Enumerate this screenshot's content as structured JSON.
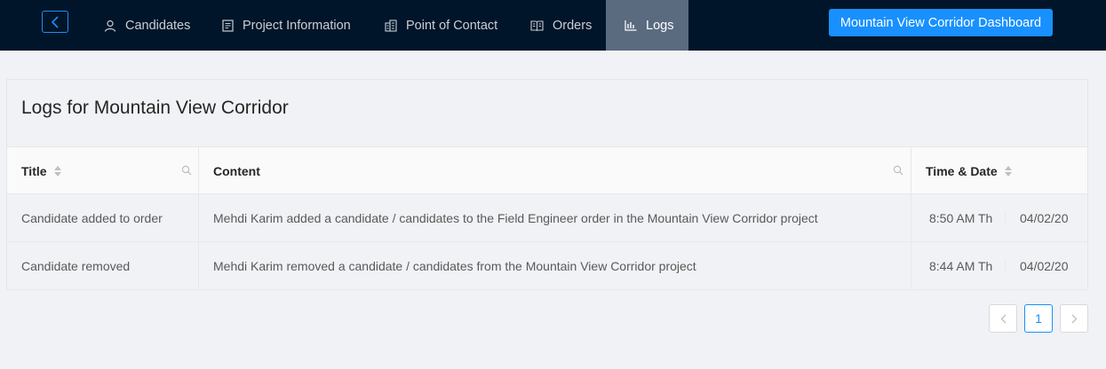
{
  "nav": {
    "items": [
      {
        "label": "Candidates",
        "icon": "user-icon"
      },
      {
        "label": "Project Information",
        "icon": "document-icon"
      },
      {
        "label": "Point of Contact",
        "icon": "building-icon"
      },
      {
        "label": "Orders",
        "icon": "book-icon"
      },
      {
        "label": "Logs",
        "icon": "bar-chart-icon",
        "active": true
      }
    ],
    "dashboard_button": "Mountain View Corridor Dashboard"
  },
  "logs": {
    "title": "Logs for Mountain View Corridor",
    "columns": [
      "Title",
      "Content",
      "Time & Date"
    ],
    "rows": [
      {
        "title": "Candidate added to order",
        "content": "Mehdi Karim added a candidate / candidates to the Field Engineer order in the Mountain View Corridor project",
        "time": "8:50 AM Th",
        "date": "04/02/20"
      },
      {
        "title": "Candidate removed",
        "content": "Mehdi Karim removed a candidate / candidates from the Mountain View Corridor project",
        "time": "8:44 AM Th",
        "date": "04/02/20"
      }
    ]
  },
  "pagination": {
    "current": "1"
  },
  "colors": {
    "topbar": "#001529",
    "primary": "#1890ff",
    "active_tab": "#5a6b80"
  }
}
